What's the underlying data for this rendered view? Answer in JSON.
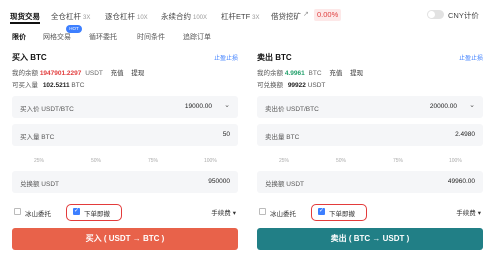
{
  "tabs": [
    {
      "label": "现货交易",
      "mult": ""
    },
    {
      "label": "全仓杠杆",
      "mult": "3X"
    },
    {
      "label": "逐仓杠杆",
      "mult": "10X"
    },
    {
      "label": "永续合约",
      "mult": "100X"
    },
    {
      "label": "杠杆ETF",
      "mult": "3X"
    },
    {
      "label": "借贷挖矿",
      "mult": ""
    }
  ],
  "mining_pct": "0.00%",
  "cny_label": "CNY计价",
  "cny_toggle_on": false,
  "subtabs": [
    "限价",
    "网格交易",
    "循环委托",
    "时间条件",
    "追踪订单"
  ],
  "hot_badge": "HOT",
  "buy": {
    "title": "买入 BTC",
    "stop_loss": "止盈止损",
    "balance_label": "我的余额",
    "balance_value": "1947901.2297",
    "balance_unit": "USDT",
    "deposit": "充值",
    "withdraw": "提现",
    "available_label": "可买入量",
    "available_value": "102.5211",
    "available_unit": "BTC",
    "price_label": "买入价 USDT/BTC",
    "price_value": "19000.00",
    "amount_label": "买入量 BTC",
    "amount_value": "50",
    "slider_ticks": [
      "25%",
      "50%",
      "75%",
      "100%"
    ],
    "total_label": "兑换额 USDT",
    "total_value": "950000",
    "iceberg_label": "冰山委托",
    "iceberg_checked": false,
    "instant_cancel_label": "下单即撤",
    "instant_cancel_checked": true,
    "fee_label": "手续费",
    "button_label": "买入 ( USDT → BTC )",
    "button_color": "#e8624a"
  },
  "sell": {
    "title": "卖出 BTC",
    "stop_loss": "止盈止损",
    "balance_label": "我的余额",
    "balance_value": "4.9961",
    "balance_unit": "BTC",
    "deposit": "充值",
    "withdraw": "提现",
    "available_label": "可兑换额",
    "available_value": "99922",
    "available_unit": "USDT",
    "price_label": "卖出价 USDT/BTC",
    "price_value": "20000.00",
    "amount_label": "卖出量 BTC",
    "amount_value": "2.4980",
    "slider_ticks": [
      "25%",
      "50%",
      "75%",
      "100%"
    ],
    "total_label": "兑换额 USDT",
    "total_value": "49960.00",
    "iceberg_label": "冰山委托",
    "iceberg_checked": false,
    "instant_cancel_label": "下单即撤",
    "instant_cancel_checked": true,
    "fee_label": "手续费",
    "button_label": "卖出 ( BTC → USDT )",
    "button_color": "#217f86"
  },
  "colors": {
    "accent_blue": "#3d7fff",
    "highlight_red": "#e33b3b",
    "balance_red": "#e23d3d",
    "balance_green": "#22a06b"
  }
}
